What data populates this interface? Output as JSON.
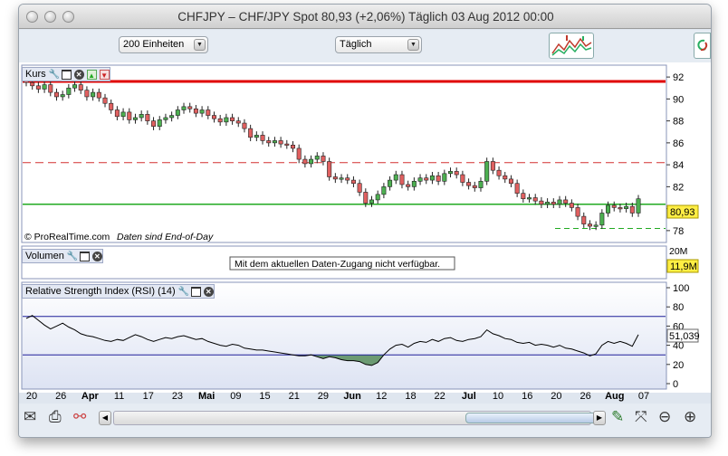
{
  "window": {
    "title": "CHFJPY – CHF/JPY Spot    80,93 (+2,06%)    Täglich  03 Aug 2012 00:00"
  },
  "toolbar": {
    "units_select": "200 Einheiten",
    "period_select": "Täglich"
  },
  "panels": {
    "price": {
      "label": "Kurs",
      "attribution": "© ProRealTime.com",
      "eod_note": "Daten sind End-of-Day",
      "last_price": "80,93",
      "y_ticks": [
        "92",
        "90",
        "88",
        "86",
        "84",
        "82",
        "80",
        "78"
      ]
    },
    "volume": {
      "label": "Volumen",
      "message": "Mit dem aktuellen Daten-Zugang nicht verfügbar.",
      "y_tick": "20M",
      "last_volume": "11,9M"
    },
    "rsi": {
      "label": "Relative Strength Index (RSI) (14)",
      "last_value": "51,039",
      "y_ticks": [
        "100",
        "80",
        "60",
        "40",
        "20",
        "0"
      ]
    }
  },
  "x_axis": {
    "labels": [
      {
        "text": "20",
        "bold": false
      },
      {
        "text": "26",
        "bold": false
      },
      {
        "text": "Apr",
        "bold": true
      },
      {
        "text": "11",
        "bold": false
      },
      {
        "text": "17",
        "bold": false
      },
      {
        "text": "23",
        "bold": false
      },
      {
        "text": "Mai",
        "bold": true
      },
      {
        "text": "09",
        "bold": false
      },
      {
        "text": "15",
        "bold": false
      },
      {
        "text": "21",
        "bold": false
      },
      {
        "text": "29",
        "bold": false
      },
      {
        "text": "Jun",
        "bold": true
      },
      {
        "text": "12",
        "bold": false
      },
      {
        "text": "18",
        "bold": false
      },
      {
        "text": "22",
        "bold": false
      },
      {
        "text": "Jul",
        "bold": true
      },
      {
        "text": "10",
        "bold": false
      },
      {
        "text": "16",
        "bold": false
      },
      {
        "text": "20",
        "bold": false
      },
      {
        "text": "26",
        "bold": false
      },
      {
        "text": "Aug",
        "bold": true
      },
      {
        "text": "07",
        "bold": false
      }
    ]
  },
  "colors": {
    "up_candle": "#4caf50",
    "down_candle": "#e06060",
    "resistance_solid": "#e00000",
    "resistance_dashed": "#d43030",
    "support_line": "#22aa22",
    "rsi_band": "#1f1f9a",
    "rsi_fill": "#6b9a72",
    "last_price_bg": "#ffee44"
  },
  "chart_data": {
    "type": "candlestick",
    "ylim": [
      77,
      93
    ],
    "levels": {
      "resistance": 91.6,
      "dashed_resistance": 84.2,
      "support": 80.4,
      "dashed_support": 78.2
    },
    "closes": [
      91.5,
      91.2,
      90.9,
      91.3,
      90.6,
      90.2,
      90.4,
      91.0,
      91.3,
      90.8,
      90.2,
      90.6,
      90.1,
      89.6,
      89.0,
      88.4,
      88.8,
      88.1,
      88.3,
      88.6,
      88.0,
      87.5,
      88.1,
      88.3,
      88.5,
      89.0,
      89.3,
      89.1,
      88.7,
      89.0,
      88.5,
      88.2,
      87.9,
      88.3,
      88.0,
      87.8,
      87.3,
      86.5,
      86.7,
      86.2,
      86.0,
      86.2,
      85.9,
      85.8,
      85.5,
      84.5,
      84.1,
      84.5,
      84.8,
      84.3,
      82.9,
      82.7,
      82.8,
      82.6,
      82.3,
      81.5,
      80.5,
      80.8,
      81.3,
      82.0,
      82.6,
      83.1,
      82.2,
      82.0,
      82.5,
      82.8,
      82.6,
      83.0,
      82.5,
      83.2,
      83.4,
      83.1,
      82.4,
      82.1,
      81.9,
      82.5,
      84.3,
      83.5,
      83.0,
      82.7,
      82.3,
      81.4,
      80.9,
      81.0,
      80.7,
      80.4,
      80.6,
      80.4,
      80.8,
      80.5,
      80.1,
      79.3,
      78.6,
      78.4,
      78.5,
      79.6,
      80.3,
      80.1,
      80.0,
      80.2,
      79.6,
      80.9
    ],
    "rsi": [
      68,
      71,
      66,
      61,
      57,
      60,
      63,
      59,
      56,
      52,
      50,
      49,
      47,
      45,
      44,
      46,
      45,
      48,
      51,
      49,
      46,
      44,
      46,
      48,
      47,
      49,
      50,
      48,
      46,
      47,
      44,
      42,
      40,
      39,
      41,
      40,
      37,
      36,
      35,
      35,
      34,
      33,
      32,
      31,
      30,
      29,
      29,
      30,
      28,
      26,
      28,
      27,
      25,
      24,
      24,
      23,
      20,
      19,
      22,
      30,
      36,
      40,
      41,
      38,
      42,
      44,
      43,
      46,
      44,
      47,
      48,
      45,
      44,
      46,
      47,
      49,
      56,
      52,
      50,
      47,
      46,
      43,
      42,
      43,
      40,
      41,
      40,
      38,
      40,
      37,
      36,
      34,
      32,
      29,
      31,
      40,
      44,
      42,
      44,
      42,
      39,
      51
    ],
    "rsi_levels": [
      70,
      30
    ]
  }
}
